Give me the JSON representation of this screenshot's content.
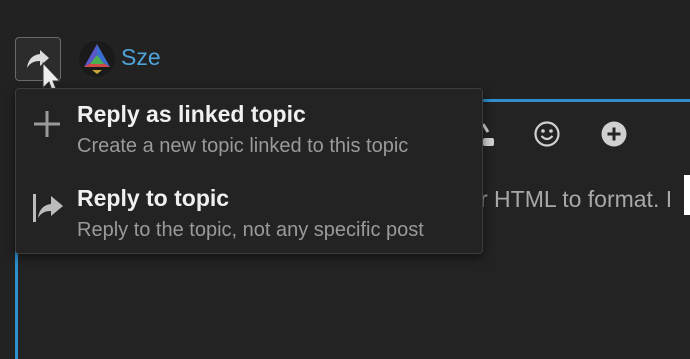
{
  "reply": {
    "toggle_icon": "reply-share-icon",
    "username": "Sze"
  },
  "editor": {
    "placeholder_fragment": "r HTML to format. I",
    "toolbar_icons": [
      "lock-icon",
      "emoji-icon",
      "plus-circle-icon"
    ]
  },
  "menu": {
    "items": [
      {
        "icon": "plus-icon",
        "title": "Reply as linked topic",
        "description": "Create a new topic linked to this topic"
      },
      {
        "icon": "reply-to-topic-icon",
        "title": "Reply to topic",
        "description": "Reply to the topic, not any specific post"
      }
    ]
  },
  "colors": {
    "background": "#222222",
    "accent": "#2f8fcd",
    "username": "#4ea3d8"
  }
}
